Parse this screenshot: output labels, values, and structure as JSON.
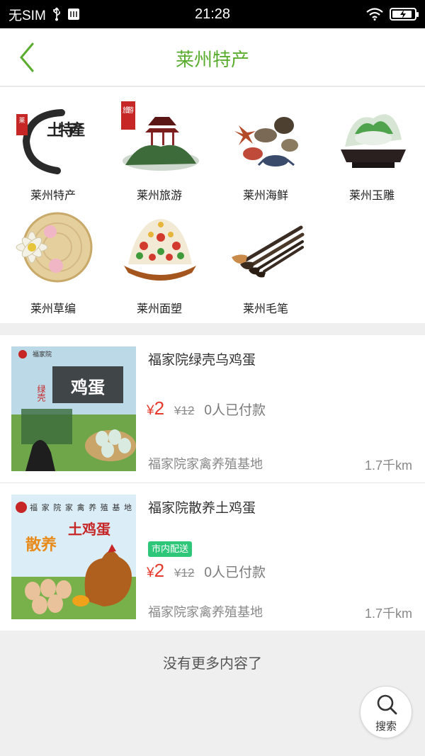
{
  "status_bar": {
    "carrier": "无SIM",
    "time": "21:28",
    "battery_level": 0.9
  },
  "header": {
    "title": "莱州特产",
    "back_icon": "chevron-left-icon"
  },
  "categories": [
    {
      "label": "莱州特产",
      "image": "tuteChan-calligraphy-image",
      "seal1": "莱",
      "seal2": "土特產"
    },
    {
      "label": "莱州旅游",
      "image": "pavilion-landscape-image",
      "seal1": "旅游"
    },
    {
      "label": "莱州海鲜",
      "image": "seafood-image"
    },
    {
      "label": "莱州玉雕",
      "image": "jade-carving-image"
    },
    {
      "label": "莱州草编",
      "image": "straw-weaving-image"
    },
    {
      "label": "莱州面塑",
      "image": "dough-sculpture-image"
    },
    {
      "label": "莱州毛笔",
      "image": "brushes-image"
    }
  ],
  "products": [
    {
      "name": "福家院绿壳乌鸡蛋",
      "price_symbol": "¥",
      "price": "2",
      "old_price": "¥12",
      "paid": "0人已付款",
      "shop": "福家院家禽养殖基地",
      "distance": "1.7千km",
      "tag": "",
      "thumb_text": {
        "brand": "福家院",
        "title": "鸡蛋",
        "badge": "绿壳"
      }
    },
    {
      "name": "福家院散养土鸡蛋",
      "price_symbol": "¥",
      "price": "2",
      "old_price": "¥12",
      "paid": "0人已付款",
      "shop": "福家院家禽养殖基地",
      "distance": "1.7千km",
      "tag": "市内配送",
      "thumb_text": {
        "brand": "福家院家禽养殖基地",
        "title": "土鸡蛋",
        "badge": "散养"
      }
    }
  ],
  "footer_text": "没有更多内容了",
  "search_fab": {
    "label": "搜索",
    "icon": "search-icon"
  },
  "colors": {
    "accent": "#5aac2f",
    "price": "#e63a2e",
    "tag": "#2ec77a"
  }
}
